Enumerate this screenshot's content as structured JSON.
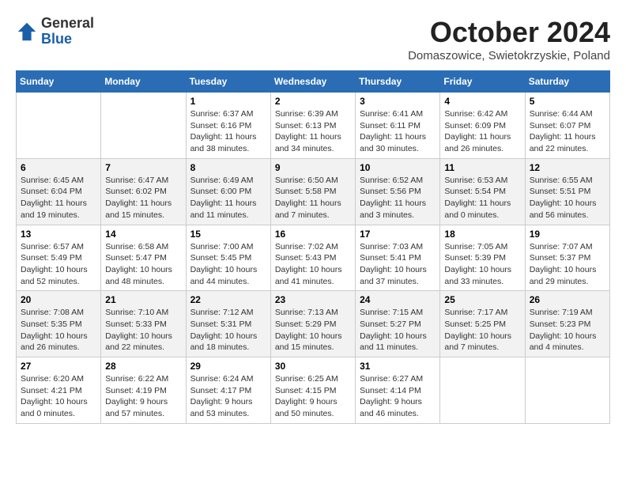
{
  "header": {
    "logo_general": "General",
    "logo_blue": "Blue",
    "month_title": "October 2024",
    "location": "Domaszowice, Swietokrzyskie, Poland"
  },
  "weekdays": [
    "Sunday",
    "Monday",
    "Tuesday",
    "Wednesday",
    "Thursday",
    "Friday",
    "Saturday"
  ],
  "weeks": [
    [
      {
        "day": "",
        "info": ""
      },
      {
        "day": "",
        "info": ""
      },
      {
        "day": "1",
        "info": "Sunrise: 6:37 AM\nSunset: 6:16 PM\nDaylight: 11 hours\nand 38 minutes."
      },
      {
        "day": "2",
        "info": "Sunrise: 6:39 AM\nSunset: 6:13 PM\nDaylight: 11 hours\nand 34 minutes."
      },
      {
        "day": "3",
        "info": "Sunrise: 6:41 AM\nSunset: 6:11 PM\nDaylight: 11 hours\nand 30 minutes."
      },
      {
        "day": "4",
        "info": "Sunrise: 6:42 AM\nSunset: 6:09 PM\nDaylight: 11 hours\nand 26 minutes."
      },
      {
        "day": "5",
        "info": "Sunrise: 6:44 AM\nSunset: 6:07 PM\nDaylight: 11 hours\nand 22 minutes."
      }
    ],
    [
      {
        "day": "6",
        "info": "Sunrise: 6:45 AM\nSunset: 6:04 PM\nDaylight: 11 hours\nand 19 minutes."
      },
      {
        "day": "7",
        "info": "Sunrise: 6:47 AM\nSunset: 6:02 PM\nDaylight: 11 hours\nand 15 minutes."
      },
      {
        "day": "8",
        "info": "Sunrise: 6:49 AM\nSunset: 6:00 PM\nDaylight: 11 hours\nand 11 minutes."
      },
      {
        "day": "9",
        "info": "Sunrise: 6:50 AM\nSunset: 5:58 PM\nDaylight: 11 hours\nand 7 minutes."
      },
      {
        "day": "10",
        "info": "Sunrise: 6:52 AM\nSunset: 5:56 PM\nDaylight: 11 hours\nand 3 minutes."
      },
      {
        "day": "11",
        "info": "Sunrise: 6:53 AM\nSunset: 5:54 PM\nDaylight: 11 hours\nand 0 minutes."
      },
      {
        "day": "12",
        "info": "Sunrise: 6:55 AM\nSunset: 5:51 PM\nDaylight: 10 hours\nand 56 minutes."
      }
    ],
    [
      {
        "day": "13",
        "info": "Sunrise: 6:57 AM\nSunset: 5:49 PM\nDaylight: 10 hours\nand 52 minutes."
      },
      {
        "day": "14",
        "info": "Sunrise: 6:58 AM\nSunset: 5:47 PM\nDaylight: 10 hours\nand 48 minutes."
      },
      {
        "day": "15",
        "info": "Sunrise: 7:00 AM\nSunset: 5:45 PM\nDaylight: 10 hours\nand 44 minutes."
      },
      {
        "day": "16",
        "info": "Sunrise: 7:02 AM\nSunset: 5:43 PM\nDaylight: 10 hours\nand 41 minutes."
      },
      {
        "day": "17",
        "info": "Sunrise: 7:03 AM\nSunset: 5:41 PM\nDaylight: 10 hours\nand 37 minutes."
      },
      {
        "day": "18",
        "info": "Sunrise: 7:05 AM\nSunset: 5:39 PM\nDaylight: 10 hours\nand 33 minutes."
      },
      {
        "day": "19",
        "info": "Sunrise: 7:07 AM\nSunset: 5:37 PM\nDaylight: 10 hours\nand 29 minutes."
      }
    ],
    [
      {
        "day": "20",
        "info": "Sunrise: 7:08 AM\nSunset: 5:35 PM\nDaylight: 10 hours\nand 26 minutes."
      },
      {
        "day": "21",
        "info": "Sunrise: 7:10 AM\nSunset: 5:33 PM\nDaylight: 10 hours\nand 22 minutes."
      },
      {
        "day": "22",
        "info": "Sunrise: 7:12 AM\nSunset: 5:31 PM\nDaylight: 10 hours\nand 18 minutes."
      },
      {
        "day": "23",
        "info": "Sunrise: 7:13 AM\nSunset: 5:29 PM\nDaylight: 10 hours\nand 15 minutes."
      },
      {
        "day": "24",
        "info": "Sunrise: 7:15 AM\nSunset: 5:27 PM\nDaylight: 10 hours\nand 11 minutes."
      },
      {
        "day": "25",
        "info": "Sunrise: 7:17 AM\nSunset: 5:25 PM\nDaylight: 10 hours\nand 7 minutes."
      },
      {
        "day": "26",
        "info": "Sunrise: 7:19 AM\nSunset: 5:23 PM\nDaylight: 10 hours\nand 4 minutes."
      }
    ],
    [
      {
        "day": "27",
        "info": "Sunrise: 6:20 AM\nSunset: 4:21 PM\nDaylight: 10 hours\nand 0 minutes."
      },
      {
        "day": "28",
        "info": "Sunrise: 6:22 AM\nSunset: 4:19 PM\nDaylight: 9 hours\nand 57 minutes."
      },
      {
        "day": "29",
        "info": "Sunrise: 6:24 AM\nSunset: 4:17 PM\nDaylight: 9 hours\nand 53 minutes."
      },
      {
        "day": "30",
        "info": "Sunrise: 6:25 AM\nSunset: 4:15 PM\nDaylight: 9 hours\nand 50 minutes."
      },
      {
        "day": "31",
        "info": "Sunrise: 6:27 AM\nSunset: 4:14 PM\nDaylight: 9 hours\nand 46 minutes."
      },
      {
        "day": "",
        "info": ""
      },
      {
        "day": "",
        "info": ""
      }
    ]
  ]
}
